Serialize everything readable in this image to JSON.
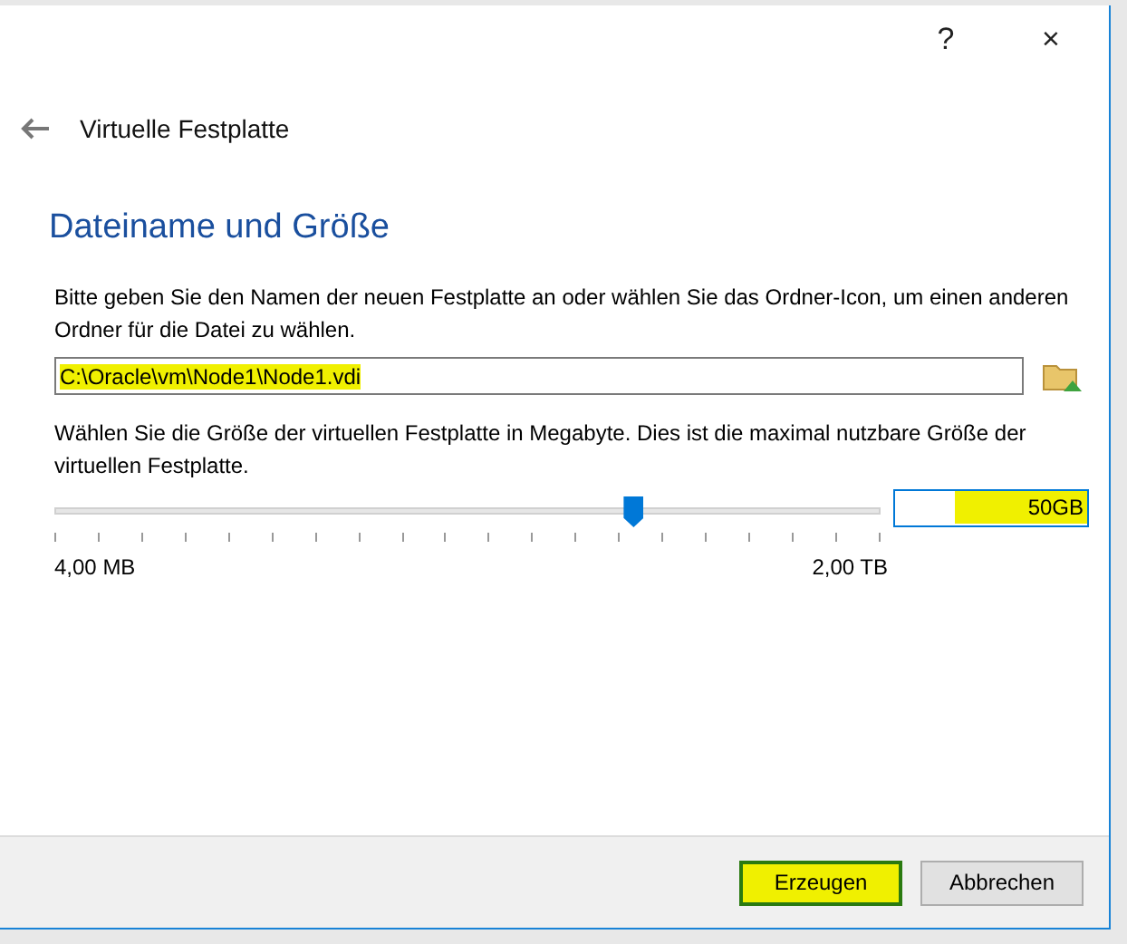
{
  "window": {
    "help": "?",
    "close": "×"
  },
  "header": {
    "title": "Virtuelle Festplatte"
  },
  "section": {
    "heading": "Dateiname und Größe"
  },
  "location": {
    "description": "Bitte geben Sie den Namen der neuen Festplatte an oder wählen Sie das Ordner-Icon, um einen anderen Ordner für die Datei zu wählen.",
    "value": "C:\\Oracle\\vm\\Node1\\Node1.vdi",
    "highlighted": true
  },
  "size": {
    "description": "Wählen Sie die Größe der virtuellen Festplatte in Megabyte. Dies ist die maximal nutzbare Größe der virtuellen Festplatte.",
    "level": 0.7,
    "value": "50GB",
    "highlighted": true,
    "min_label": "4,00 MB",
    "max_label": "2,00 TB"
  },
  "buttons": [
    {
      "label": "Erzeugen",
      "default": true,
      "highlighted": true
    },
    {
      "label": "Abbrechen",
      "default": false,
      "highlighted": false
    }
  ]
}
